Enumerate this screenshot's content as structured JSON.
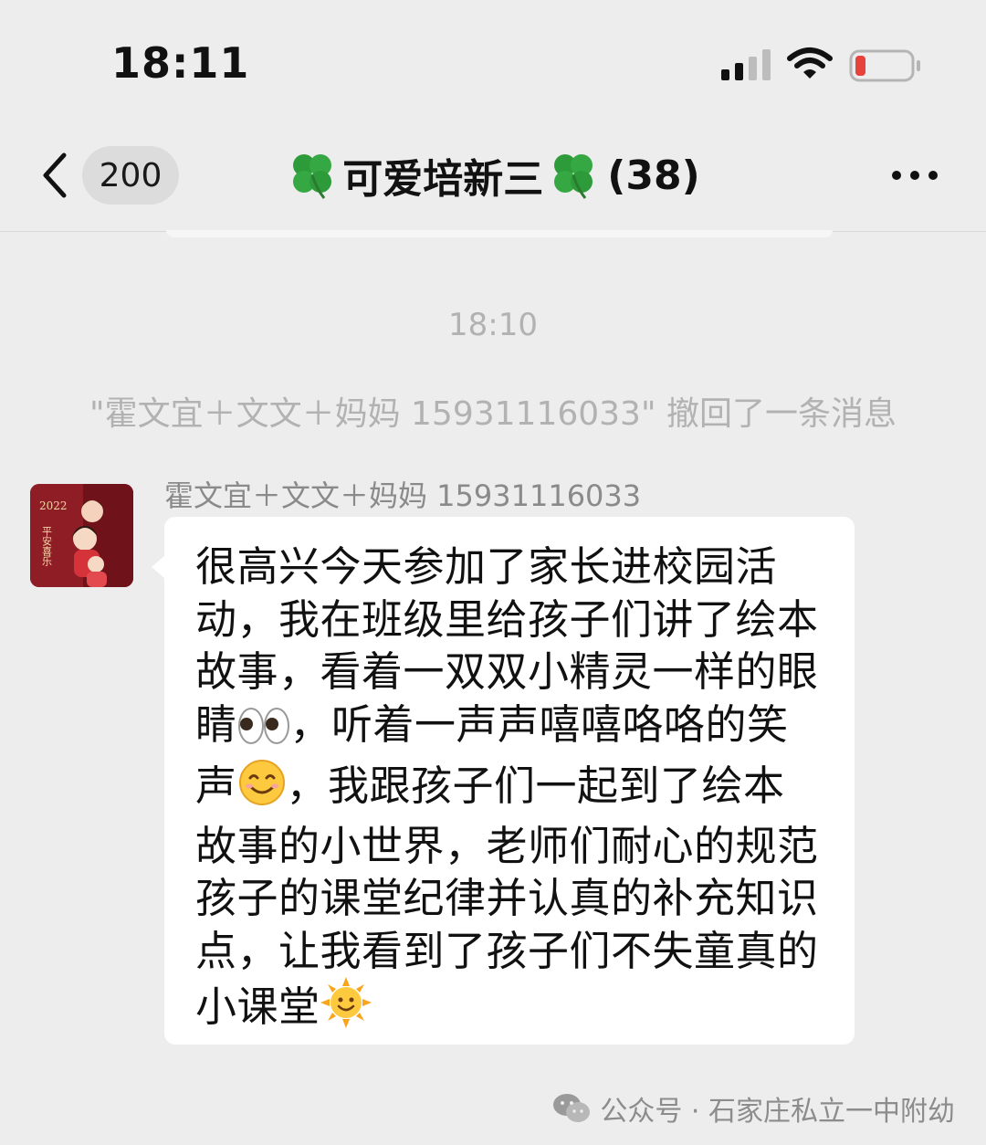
{
  "status_bar": {
    "time": "18:11",
    "battery_color": "#e5433b"
  },
  "header": {
    "back_icon": "chevron-left-icon",
    "unread_count": "200",
    "title": "可爱培新三",
    "title_icon": "four-leaf-clover-icon",
    "member_count": "(38)",
    "more_icon": "more-horizontal-icon"
  },
  "messages": {
    "timestamp": "18:10",
    "recall_notice": "\"霍文宜＋文文＋妈妈 15931116033\" 撤回了一条消息",
    "items": [
      {
        "sender": "霍文宜＋文文＋妈妈 15931116033",
        "avatar_text": [
          "2022",
          "平安喜乐"
        ],
        "text_part1": "很高兴今天参加了家长进校园活动，我在班级里给孩子们讲了绘本故事，看着一双双小精灵一样的眼睛",
        "emoji1": "👀",
        "text_part2": "，听着一声声嘻嘻咯咯的笑声",
        "emoji2": "😊",
        "text_part3": "，我跟孩子们一起到了绘本故事的小世界，老师们耐心的规范孩子的课堂纪律并认真的补充知识点，让我看到了孩子们不失童真的小课堂",
        "emoji3": "🌞"
      }
    ]
  },
  "watermark": {
    "text": "公众号 · 石家庄私立一中附幼",
    "icon": "wechat-icon"
  },
  "colors": {
    "background": "#ededed",
    "bubble": "#ffffff",
    "system_text": "#b2b2b2"
  }
}
